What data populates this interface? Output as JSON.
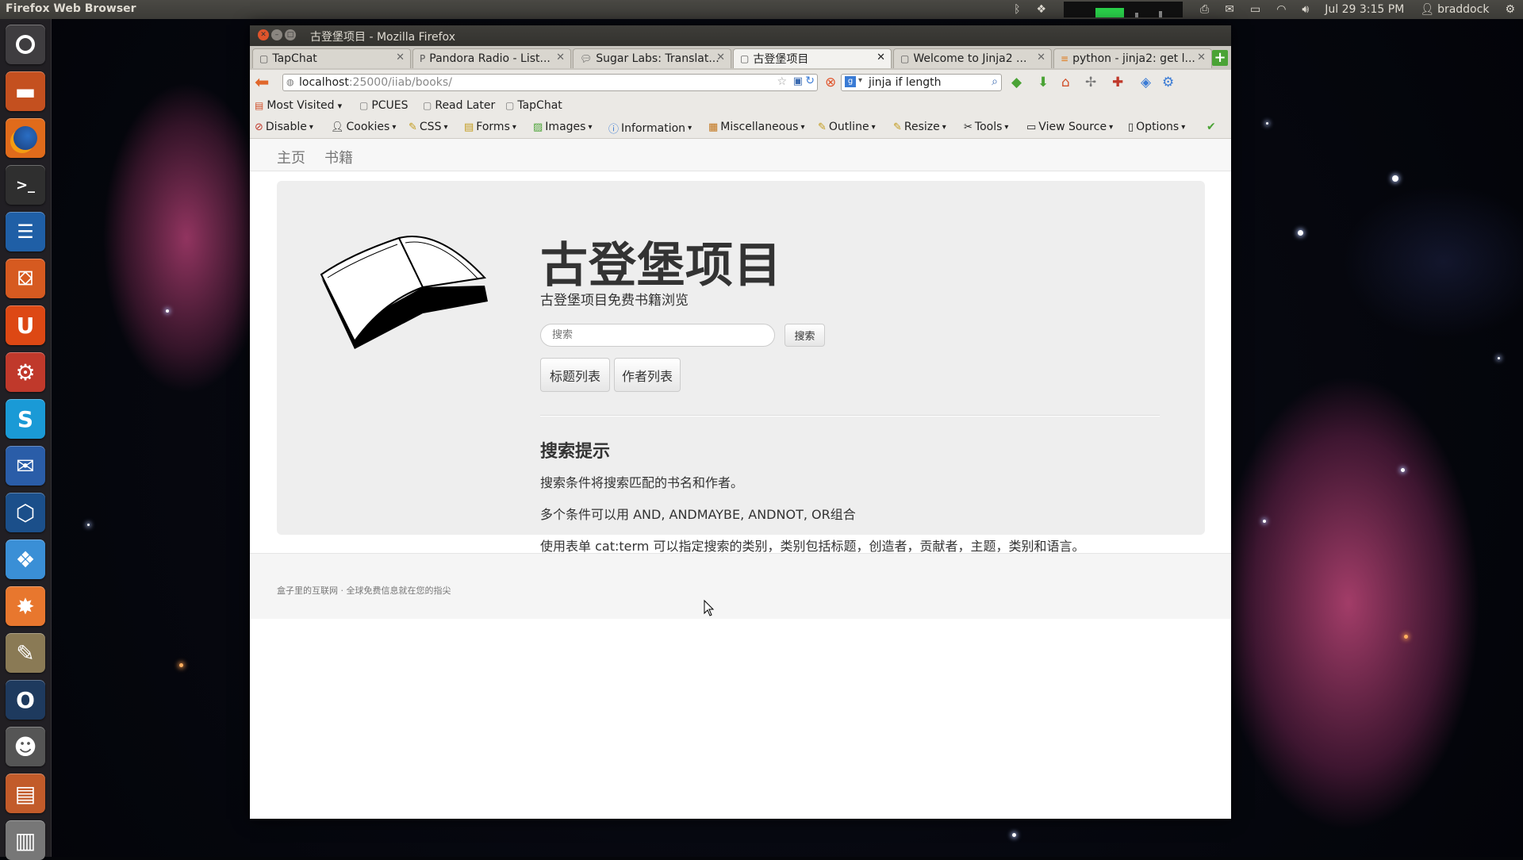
{
  "panel": {
    "app_name": "Firefox Web Browser",
    "datetime": "Jul 29  3:15 PM",
    "username": "braddock"
  },
  "launcher": {
    "items": [
      {
        "name": "dash-home",
        "icon": "ubuntu-logo-icon",
        "color": "#3f3d40"
      },
      {
        "name": "files",
        "icon": "folder-icon",
        "color": "#c4501f"
      },
      {
        "name": "firefox",
        "icon": "firefox-icon",
        "color": "#e06b1b"
      },
      {
        "name": "terminal",
        "icon": "terminal-icon",
        "color": "#2f2f2f"
      },
      {
        "name": "libreoffice-writer",
        "icon": "document-icon",
        "color": "#1f5fa6"
      },
      {
        "name": "software-center",
        "icon": "shopping-bag-icon",
        "color": "#d65a20"
      },
      {
        "name": "ubuntu-one",
        "icon": "u-icon",
        "color": "#dd4814"
      },
      {
        "name": "system-settings",
        "icon": "wrench-icon",
        "color": "#c0392b"
      },
      {
        "name": "skype",
        "icon": "skype-icon",
        "color": "#1a9ad6"
      },
      {
        "name": "thunderbird",
        "icon": "mail-icon",
        "color": "#2a5da8"
      },
      {
        "name": "virtualbox",
        "icon": "cube-icon",
        "color": "#1b4f8a"
      },
      {
        "name": "dropbox",
        "icon": "box-icon",
        "color": "#3a8fd6"
      },
      {
        "name": "app-firework",
        "icon": "spark-icon",
        "color": "#e8772e"
      },
      {
        "name": "gimp",
        "icon": "gimp-icon",
        "color": "#8a7a55"
      },
      {
        "name": "app-o",
        "icon": "ring-icon",
        "color": "#1e3a5e"
      },
      {
        "name": "app-robot",
        "icon": "robot-icon",
        "color": "#555555"
      },
      {
        "name": "app-orange",
        "icon": "package-icon",
        "color": "#c25b2a"
      },
      {
        "name": "trash",
        "icon": "trash-icon",
        "color": "#777777"
      }
    ]
  },
  "window": {
    "title": "古登堡项目 - Mozilla Firefox"
  },
  "tabs": [
    {
      "label": "TapChat",
      "active": false
    },
    {
      "label": "Pandora Radio - List...",
      "active": false
    },
    {
      "label": "Sugar Labs: Translat...",
      "active": false
    },
    {
      "label": "古登堡项目",
      "active": true
    },
    {
      "label": "Welcome to Jinja2 ...",
      "active": false
    },
    {
      "label": "python - jinja2: get l...",
      "active": false
    }
  ],
  "navbar": {
    "url_host": "localhost",
    "url_path": ":25000/iiab/books/",
    "search_query": "jinja if length"
  },
  "bookmarks": [
    {
      "label": "Most Visited",
      "dropdown": "▾"
    },
    {
      "label": "PCUES"
    },
    {
      "label": "Read Later"
    },
    {
      "label": "TapChat"
    }
  ],
  "webdev_toolbar": [
    {
      "label": "Disable",
      "icon": "no-entry-icon"
    },
    {
      "label": "Cookies",
      "icon": "person-icon"
    },
    {
      "label": "CSS",
      "icon": "pencil-icon"
    },
    {
      "label": "Forms",
      "icon": "clipboard-icon"
    },
    {
      "label": "Images",
      "icon": "image-icon"
    },
    {
      "label": "Information",
      "icon": "info-icon"
    },
    {
      "label": "Miscellaneous",
      "icon": "box-icon"
    },
    {
      "label": "Outline",
      "icon": "pencil-icon"
    },
    {
      "label": "Resize",
      "icon": "pencil-icon"
    },
    {
      "label": "Tools",
      "icon": "tools-icon"
    },
    {
      "label": "View Source",
      "icon": "monitor-icon"
    },
    {
      "label": "Options",
      "icon": "document-icon"
    }
  ],
  "site_nav": {
    "home": "主页",
    "books": "书籍"
  },
  "hero": {
    "title": "古登堡项目",
    "subtitle": "古登堡项目免费书籍浏览",
    "search_placeholder": "搜索",
    "search_button": "搜索",
    "title_list_button": "标题列表",
    "author_list_button": "作者列表"
  },
  "tips": {
    "heading": "搜索提示",
    "line1": "搜索条件将搜索匹配的书名和作者。",
    "line2": "多个条件可以用 AND, ANDMAYBE, ANDNOT, OR组合",
    "line3": "使用表单 cat:term 可以指定搜索的类别，类别包括标题，创造者，贡献者，主题，类别和语言。"
  },
  "footer": {
    "text": "盒子里的互联网 · 全球免费信息就在您的指尖"
  }
}
